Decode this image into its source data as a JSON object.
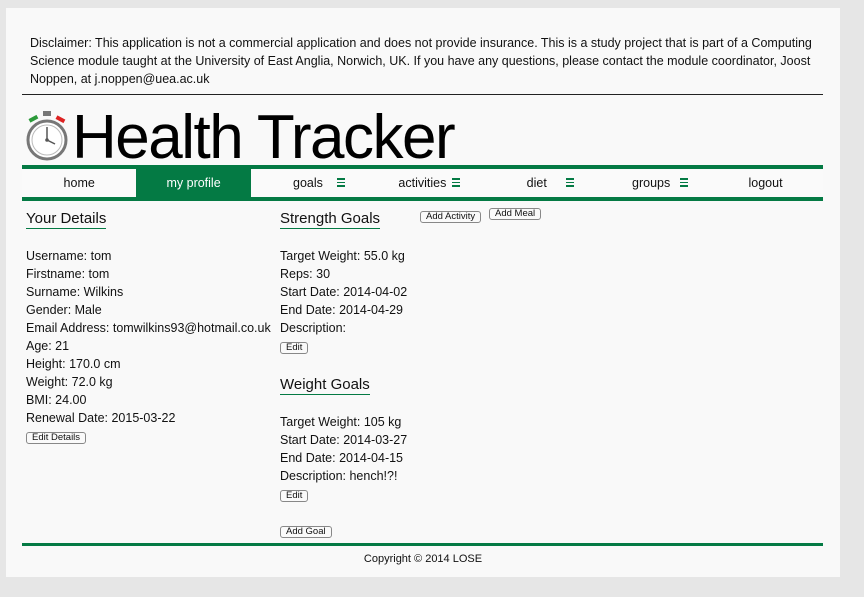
{
  "disclaimer": "Disclaimer: This application is not a commercial application and does not provide insurance. This is a study project that is part of a Computing Science module taught at the University of East Anglia, Norwich, UK. If you have any questions, please contact the module coordinator, Joost Noppen, at j.noppen@uea.ac.uk",
  "app_title": "Health Tracker",
  "accent_color": "#047a44",
  "nav": {
    "items": [
      {
        "label": "home",
        "active": false,
        "menu": false
      },
      {
        "label": "my profile",
        "active": true,
        "menu": false
      },
      {
        "label": "goals",
        "active": false,
        "menu": true
      },
      {
        "label": "activities",
        "active": false,
        "menu": true
      },
      {
        "label": "diet",
        "active": false,
        "menu": true
      },
      {
        "label": "groups",
        "active": false,
        "menu": true
      },
      {
        "label": "logout",
        "active": false,
        "menu": false
      }
    ]
  },
  "details": {
    "title": "Your Details",
    "username": "Username: tom",
    "firstname": "Firstname: tom",
    "surname": "Surname: Wilkins",
    "gender": "Gender: Male",
    "email": "Email Address: tomwilkins93@hotmail.co.uk",
    "age": "Age: 21",
    "height": "Height: 170.0 cm",
    "weight": "Weight: 72.0 kg",
    "bmi": "BMI: 24.00",
    "renewal": "Renewal Date: 2015-03-22",
    "edit_button": "Edit Details"
  },
  "strength": {
    "title": "Strength Goals",
    "target_weight": "Target Weight: 55.0 kg",
    "reps": "Reps: 30",
    "start_date": "Start Date: 2014-04-02",
    "end_date": "End Date: 2014-04-29",
    "description": "Description:",
    "edit_button": "Edit"
  },
  "weight_goals": {
    "title": "Weight Goals",
    "target_weight": "Target Weight: 105 kg",
    "start_date": "Start Date: 2014-03-27",
    "end_date": "End Date: 2014-04-15",
    "description": "Description: hench!?!",
    "edit_button": "Edit"
  },
  "add_activity_button": "Add Activity",
  "add_meal_button": "Add Meal",
  "add_goal_button": "Add Goal",
  "copyright": "Copyright © 2014 LOSE"
}
